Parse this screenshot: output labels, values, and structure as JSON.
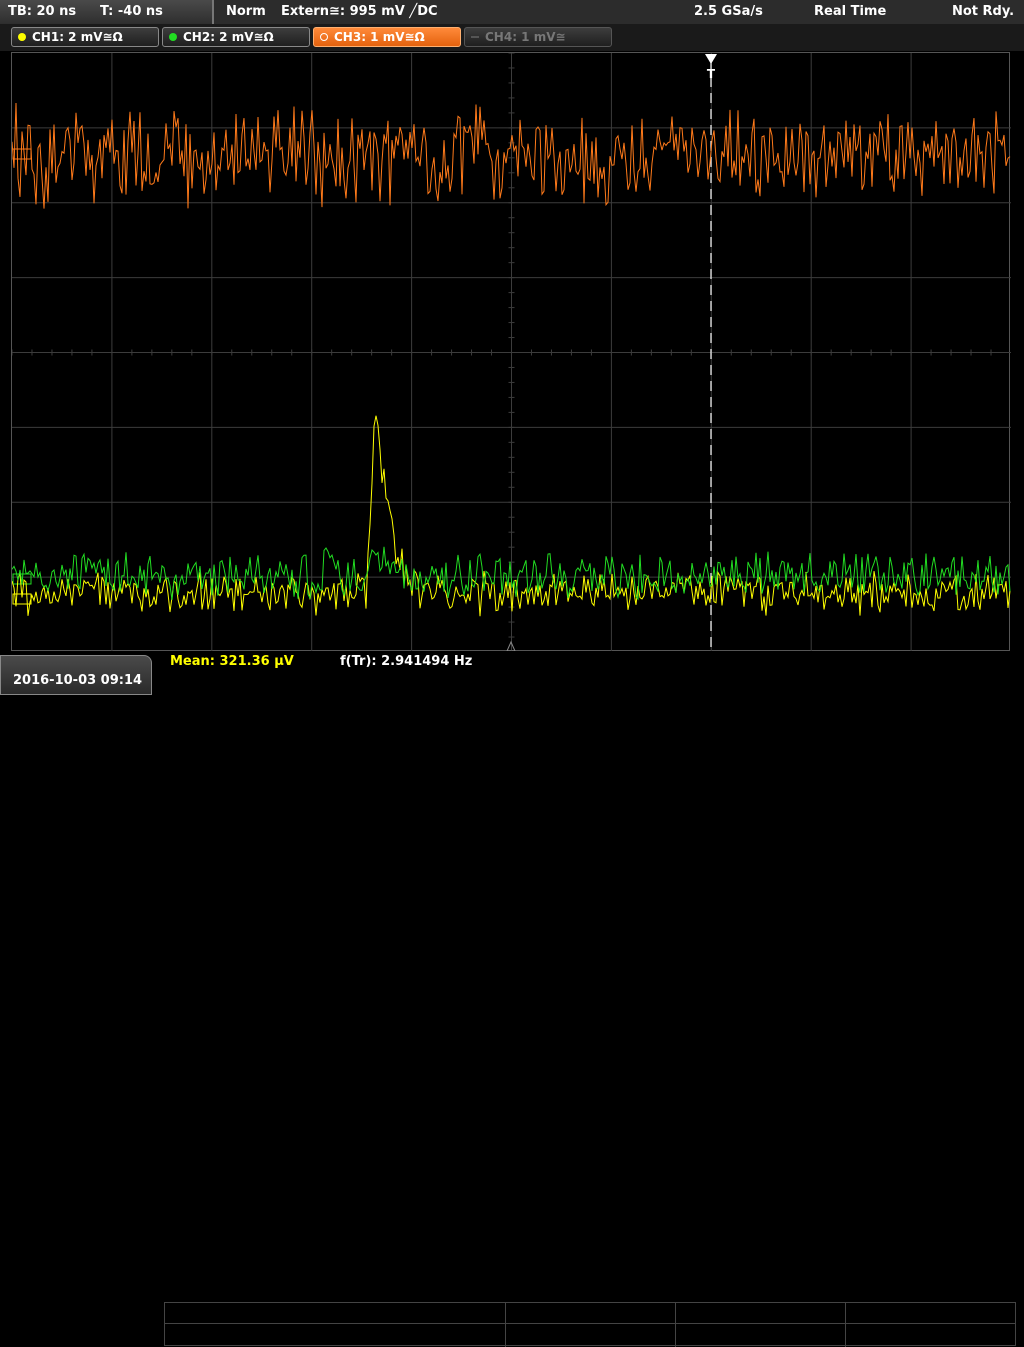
{
  "status": {
    "timebase": "TB: 20 ns",
    "trigger_time": "T: -40 ns",
    "mode": "Norm",
    "trigger_source": "Extern≅: 995 mV ╱DC",
    "sample_rate": "2.5 GSa/s",
    "acq_mode": "Real Time",
    "state": "Not Rdy."
  },
  "channels": [
    {
      "label": "CH1: 2 mV≅Ω",
      "color": "#ffff00",
      "state": "on"
    },
    {
      "label": "CH2: 2 mV≅Ω",
      "color": "#22dd22",
      "state": "on"
    },
    {
      "label": "CH3: 1 mV≅Ω",
      "color": "#ff7a1a",
      "state": "active"
    },
    {
      "label": "CH4: 1 mV≅",
      "color": "#666666",
      "state": "off"
    }
  ],
  "trigger_marker": "T",
  "measurements": {
    "mean": "Mean: 321.36 µV",
    "freq": "f(Tr): 2.941494 Hz"
  },
  "datetime": "2016-10-03 09:14",
  "colors": {
    "ch1": "#ffff00",
    "ch2": "#22dd22",
    "ch3": "#ff7a1a",
    "grid": "#3a3a3a"
  }
}
